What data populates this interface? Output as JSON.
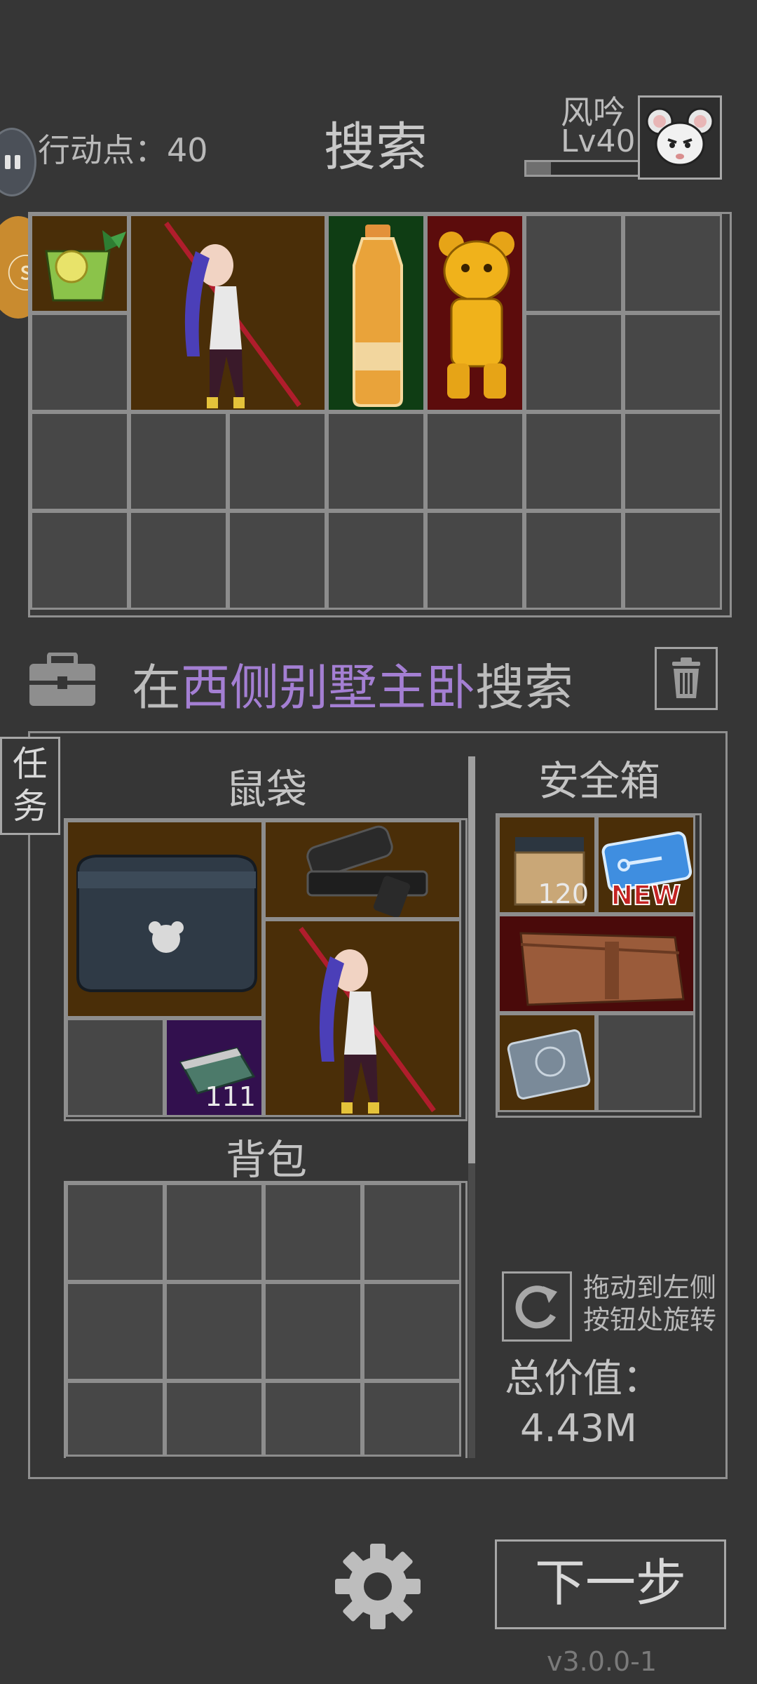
{
  "header": {
    "action_points": "行动点：40",
    "title": "搜索",
    "player_name": "风吟",
    "player_level": "Lv40",
    "level_progress": 0.22
  },
  "location": {
    "prefix": "在",
    "place": "西侧别墅主卧",
    "suffix": "搜索"
  },
  "task_tab": {
    "line1": "任",
    "line2": "务"
  },
  "rat_bag": {
    "label": "鼠袋",
    "items": [
      {
        "name": "supply-crate",
        "count": ""
      },
      {
        "name": "gun-scope",
        "count": ""
      },
      {
        "name": "anime-figure",
        "count": ""
      },
      {
        "name": "ammo-box",
        "count": "111"
      }
    ]
  },
  "safe_box": {
    "label": "安全箱",
    "items": [
      {
        "name": "ration-crate",
        "count": "120"
      },
      {
        "name": "keycard",
        "badge": "NEW"
      },
      {
        "name": "leather-wallet",
        "count": ""
      },
      {
        "name": "hard-drive",
        "count": ""
      }
    ]
  },
  "backpack": {
    "label": "背包"
  },
  "rotate_hint": {
    "line1": "拖动到左侧",
    "line2": "按钮处旋转"
  },
  "total": {
    "label": "总价值：",
    "value": "4.43M"
  },
  "footer": {
    "next_label": "下一步",
    "version": "v3.0.0-1"
  },
  "colors": {
    "accent": "#a47fd3",
    "bg": "#363636",
    "grid_line": "#8d8d8d"
  }
}
